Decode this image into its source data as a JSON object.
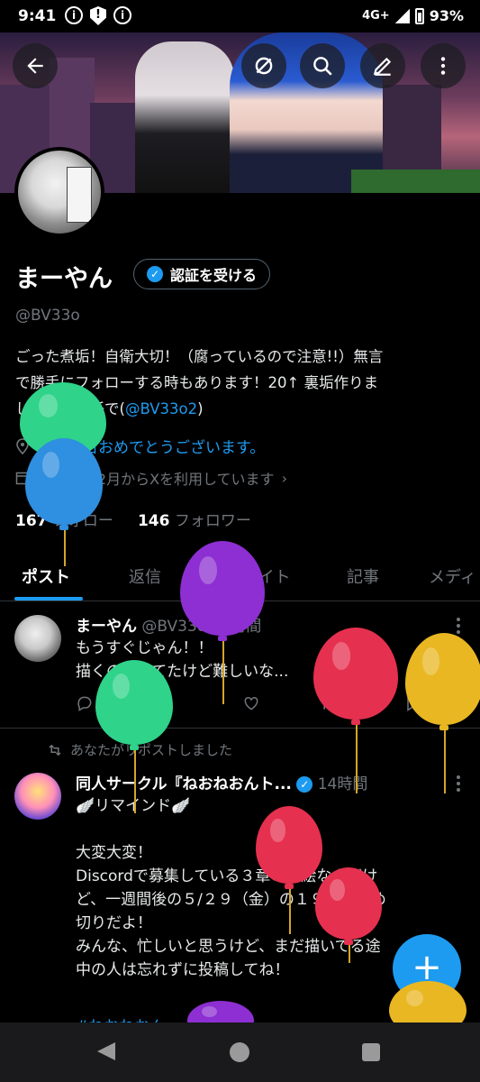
{
  "status_bar": {
    "time": "9:41",
    "network": "4G+",
    "battery": "93%"
  },
  "header": {
    "icons": [
      "back-arrow-icon",
      "grok-icon",
      "search-icon",
      "edit-icon",
      "more-vertical-icon"
    ]
  },
  "profile": {
    "name": "まーやん",
    "verify_button_label": "認証を受ける",
    "handle": "@BV33o",
    "bio_line_1": "ごった煮垢！自衛大切！（腐っているので注意!!）無言",
    "bio_line_2": "で勝手にフォローする時もあります！20↑ 裏垢作りま",
    "bio_line_3_prefix": "した自己責任で(",
    "bio_link": "@BV33o2",
    "bio_line_3_suffix": ")",
    "birthday_text": "お誕生日おめでとうございます。",
    "joined_text": "2017年12月からXを利用しています",
    "following_count": "167",
    "following_label": "フォロー",
    "followers_count": "146",
    "followers_label": "フォロワー"
  },
  "tabs": [
    {
      "label": "ポスト",
      "active": true
    },
    {
      "label": "返信",
      "active": false
    },
    {
      "label": "ハイライト",
      "active": false
    },
    {
      "label": "記事",
      "active": false
    },
    {
      "label": "メディ",
      "active": false
    }
  ],
  "posts": [
    {
      "author": "まーやん",
      "handle": "@BV33o",
      "time": "· 9時間",
      "body": "もうすぐじゃん！！\n描くの迷ってたけど難しいな...",
      "views": "33"
    },
    {
      "repost_note": "あなたがリポストしました",
      "author": "同人サークル『ねおねおんト...",
      "time": "14時間",
      "body": "🪽リマインド🪽\n\n大変大変！\nDiscordで募集している３章の挿絵なんだけ\nど、一週間後の５/２９（金）の１９時が締め\n切りだよ！\nみんな、忙しいと思うけど、まだ描いてる途\n中の人は忘れずに投稿してね！",
      "hashtag": "#ねおねおん"
    }
  ],
  "fab": {
    "label": "+"
  },
  "colors": {
    "accent": "#1d9bf0",
    "background": "#000000",
    "muted": "#71767b"
  }
}
